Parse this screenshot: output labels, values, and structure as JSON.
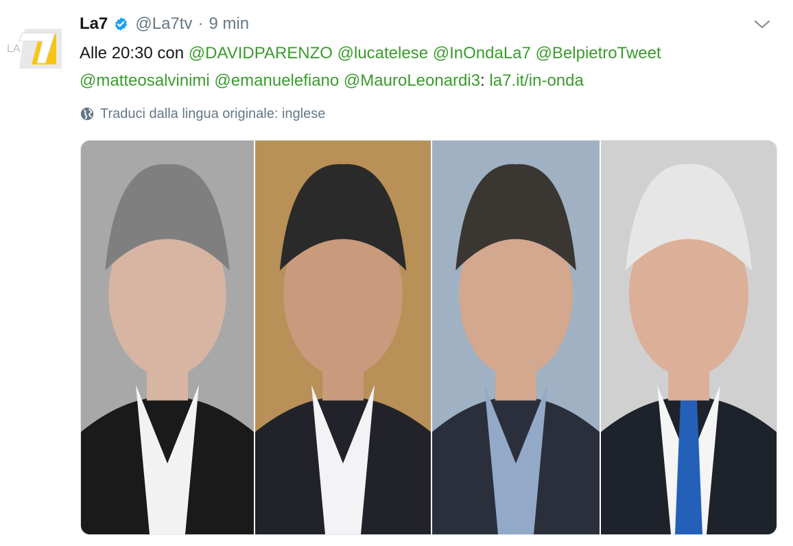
{
  "tweet": {
    "author_name": "La7",
    "handle": "@La7tv",
    "separator": "·",
    "time": "9 min",
    "text_prefix": "Alle 20:30 con ",
    "mentions": [
      "@DAVIDPARENZO",
      "@lucatelese",
      "@InOndaLa7",
      "@BelpietroTweet",
      "@matteosalvinimi",
      "@emanuelefiano",
      "@MauroLeonardi3"
    ],
    "colon": ":",
    "link": "la7.it/in-onda",
    "translate": "Traduci dalla lingua originale: inglese"
  },
  "logo": {
    "text": "LA"
  },
  "colors": {
    "link": "#3a9b2d",
    "muted": "#657786",
    "verified": "#1da1f2",
    "logo_yellow": "#f7c615"
  },
  "icons": [
    "la7-logo-icon",
    "verified-badge-icon",
    "chevron-down-icon",
    "globe-icon"
  ],
  "media": {
    "photos": [
      {
        "name": "photo-1",
        "bg": "#a8a8a8",
        "skin": "#d7b5a2",
        "hair": "#7f7f7f",
        "suit": "#1a1a1a",
        "collar": "#f2f2f2",
        "tie": ""
      },
      {
        "name": "photo-2",
        "bg": "#b89058",
        "skin": "#c99a7c",
        "hair": "#2a2a2a",
        "suit": "#22232a",
        "collar": "#f3f3f5",
        "tie": ""
      },
      {
        "name": "photo-3",
        "bg": "#9fb1c3",
        "skin": "#d4a78f",
        "hair": "#3a3632",
        "suit": "#2a2f3b",
        "collar": "#93a9c8",
        "tie": ""
      },
      {
        "name": "photo-4",
        "bg": "#d0d0d0",
        "skin": "#dcaf98",
        "hair": "#e6e6e6",
        "suit": "#1e222a",
        "collar": "#f5f5f5",
        "tie": "#2460b8"
      }
    ]
  }
}
